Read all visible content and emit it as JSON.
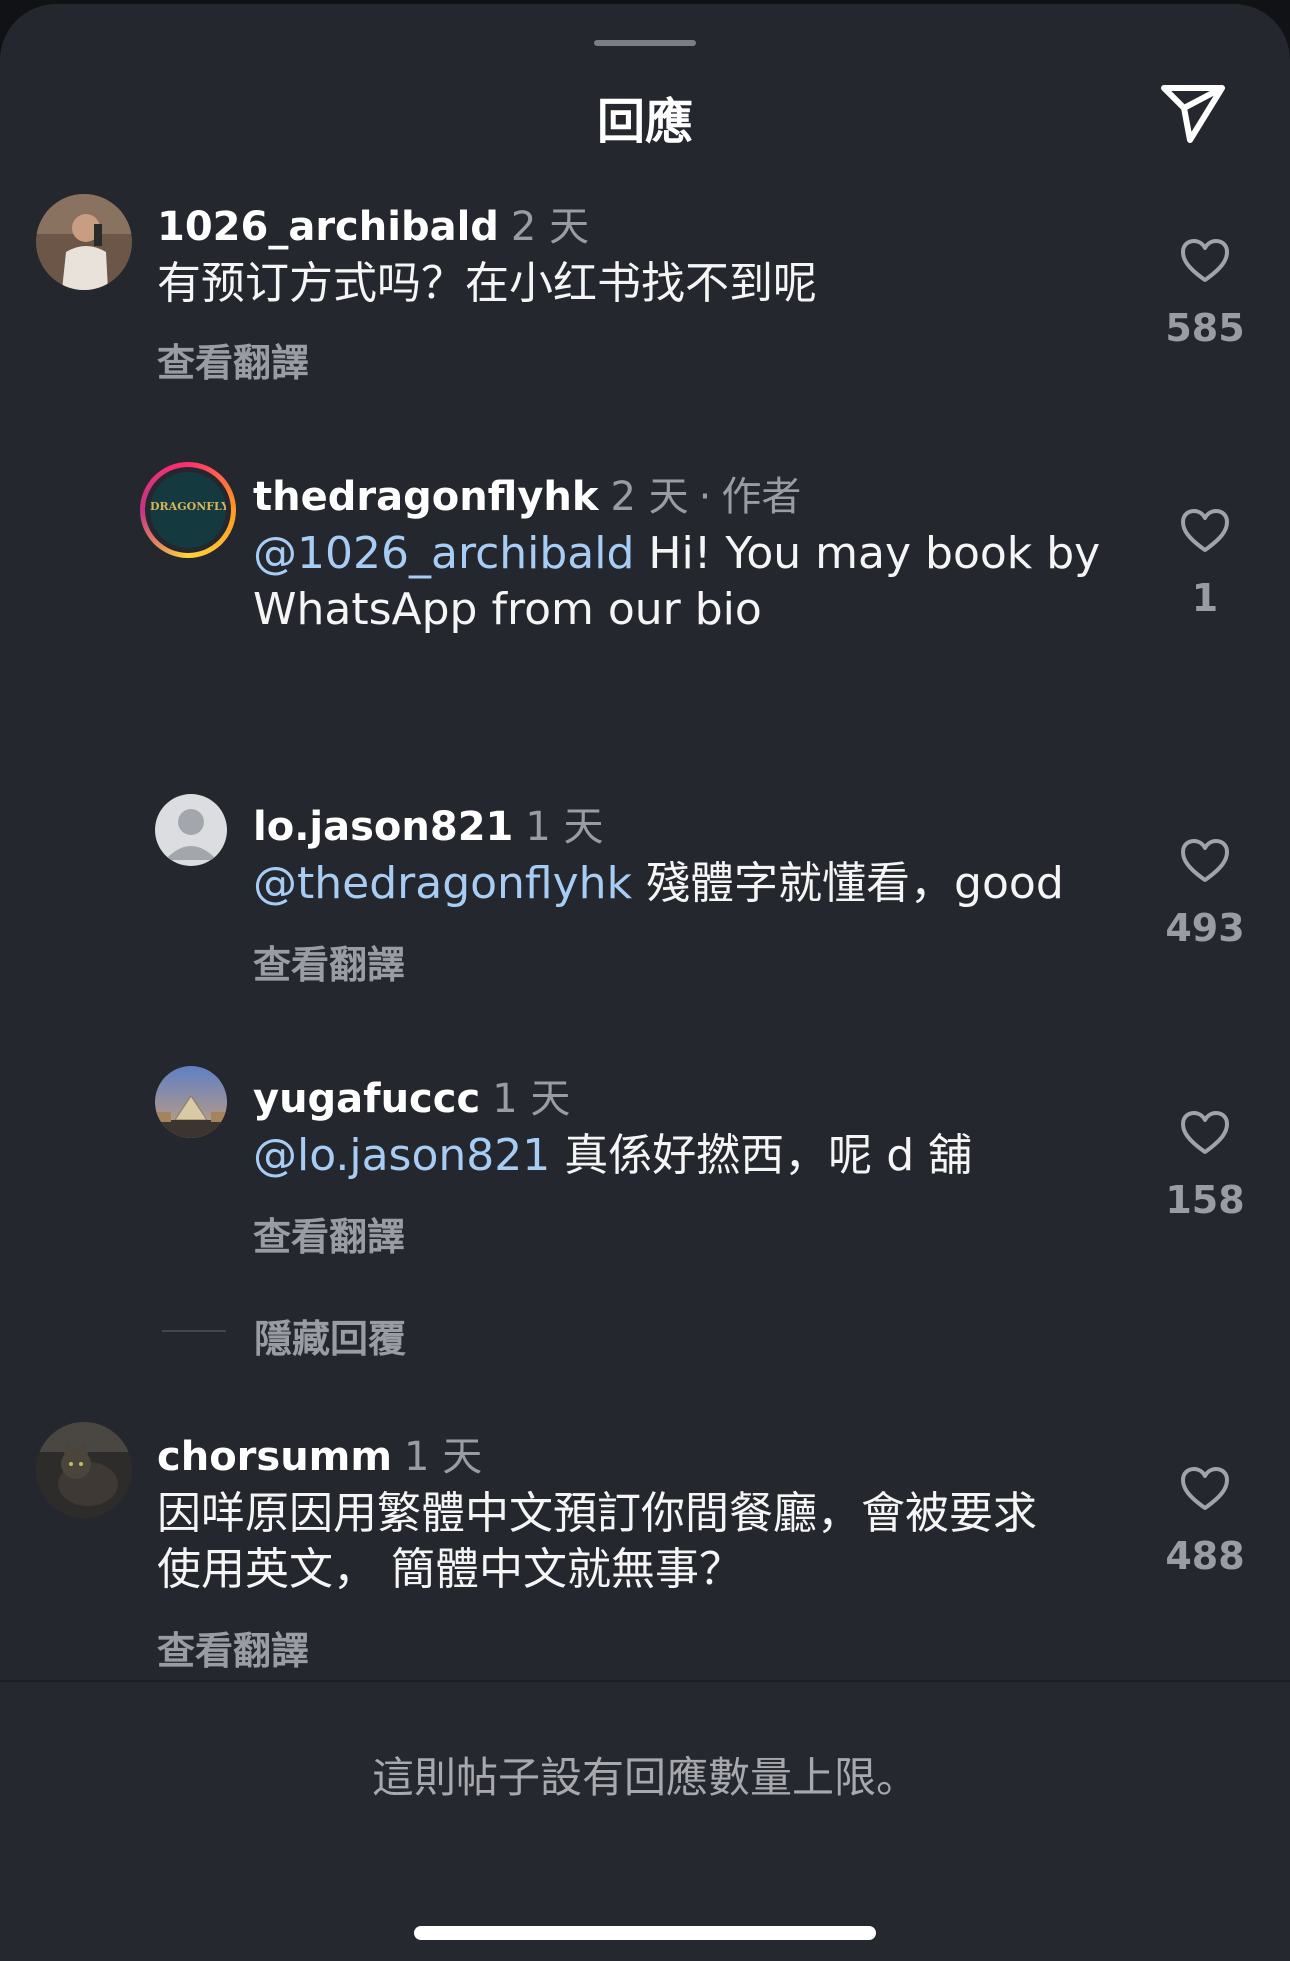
{
  "header": {
    "title": "回應"
  },
  "comments": [
    {
      "username": "1026_archibald",
      "time": "2 天",
      "text": "有预订方式吗？在小红书找不到呢",
      "translate_label": "查看翻譯",
      "likes": "585"
    },
    {
      "username": "thedragonflyhk",
      "time": "2 天",
      "author_tag": "作者",
      "separator": "·",
      "mention": "@1026_archibald",
      "text_line1": " Hi! You may book by",
      "text_line2": "WhatsApp from our bio",
      "likes": "1",
      "avatar_text": "DRAGONFLY"
    },
    {
      "username": "lo.jason821",
      "time": "1 天",
      "mention": "@thedragonflyhk",
      "text": " 殘體字就懂看，good",
      "translate_label": "查看翻譯",
      "likes": "493"
    },
    {
      "username": "yugafuccc",
      "time": "1 天",
      "mention": "@lo.jason821",
      "text": " 真係好撚西，呢 d 舖",
      "translate_label": "查看翻譯",
      "likes": "158"
    },
    {
      "username": "chorsumm",
      "time": "1 天",
      "text_line1": "因咩原因用繁體中文預訂你間餐廳，會被要求",
      "text_line2": "使用英文，  簡體中文就無事？",
      "translate_label": "查看翻譯",
      "likes": "488"
    }
  ],
  "hide_replies_label": "隱藏回覆",
  "footer": {
    "limit_note": "這則帖子設有回應數量上限。"
  },
  "icons": {
    "share": "paper-plane-icon",
    "like": "heart-outline-icon"
  },
  "colors": {
    "background": "#24272e",
    "mention": "#a8cdf5",
    "muted": "#9a9ca3"
  }
}
